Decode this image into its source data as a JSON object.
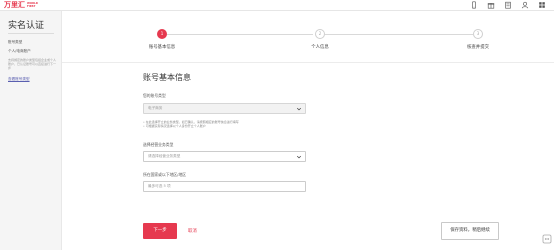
{
  "brand": {
    "name_cn": "万里汇",
    "name_en_line1": "WORLD",
    "name_en_line2": "FIRST",
    "color": "#e6394f"
  },
  "topbar": {
    "icons": [
      "mobile-icon",
      "gift-icon",
      "building-icon",
      "user-icon",
      "grid-icon"
    ]
  },
  "sidebar": {
    "title": "实名认证",
    "heading1": "账号类型",
    "heading2": "个人/电商账户",
    "note": "支持绑定的账户类型包括企业或个人账户，已认证账号可以直接进行下一步",
    "link": "查看账号类型"
  },
  "stepper": {
    "steps": [
      {
        "num": "1",
        "label": "账号基本信息",
        "state": "active"
      },
      {
        "num": "2",
        "label": "个人信息",
        "state": "inactive"
      },
      {
        "num": "3",
        "label": "核查并提交",
        "state": "inactive"
      }
    ]
  },
  "form": {
    "title": "账号基本信息",
    "account_type_label": "您的账号类型",
    "account_type_value": "电子商务",
    "notes": [
      "• 在此选择开立的业务类型，如已确认，请按照相应的账号信息进行填写",
      "• 可根据实际情况选择以个人身份开立个人账户"
    ],
    "business_label": "选择经营业务类型",
    "business_placeholder": "请选择经营业务类型",
    "country_label": "所在国家或以下地区/地区",
    "country_placeholder": "最多可选 5 项"
  },
  "actions": {
    "next": "下一步",
    "cancel": "取消",
    "save": "保存资料，稍后继续"
  }
}
